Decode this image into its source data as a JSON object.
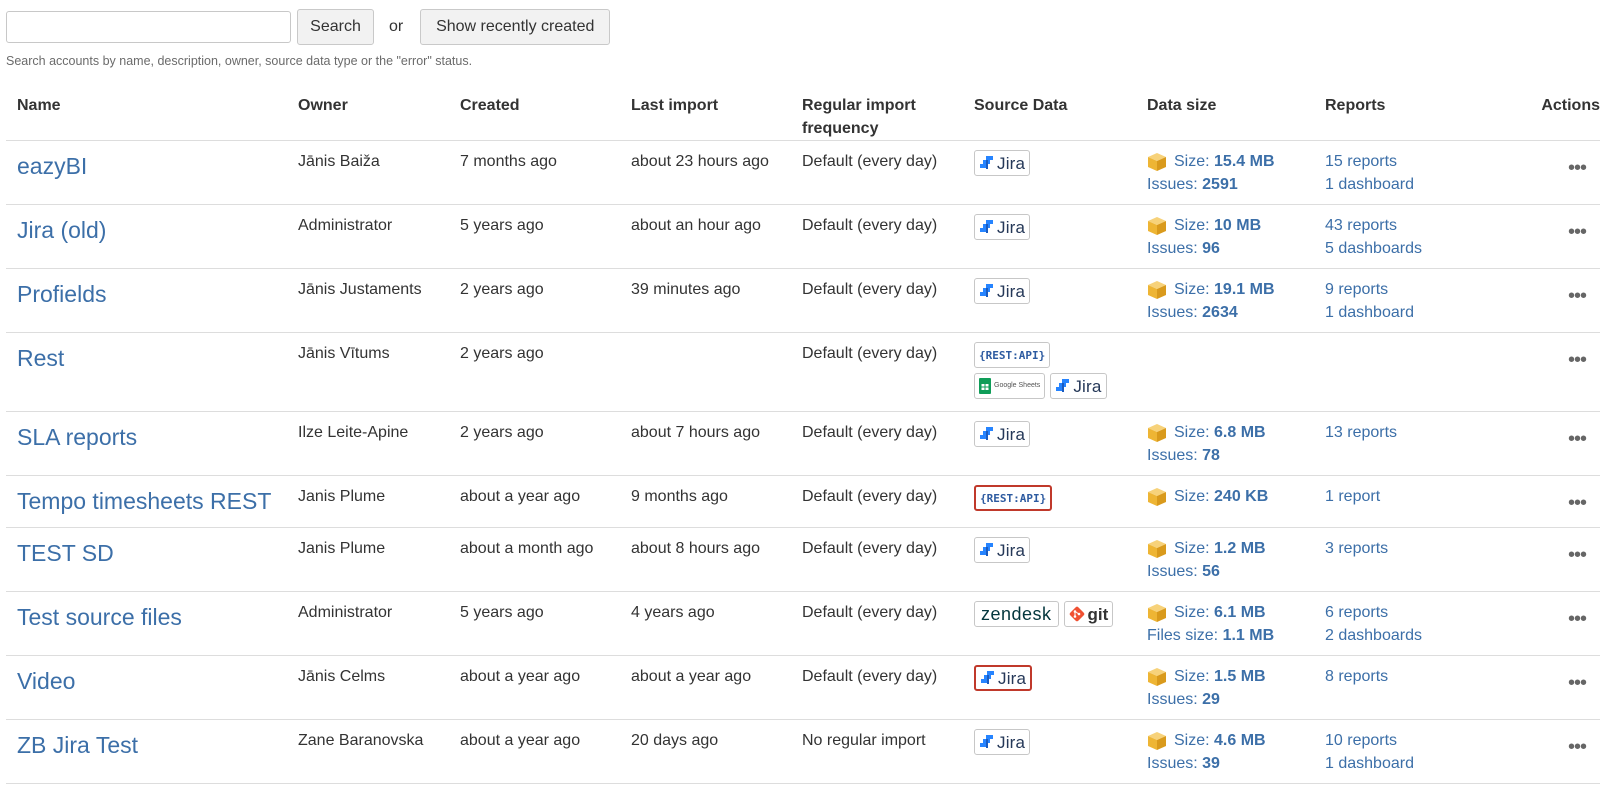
{
  "search": {
    "placeholder": "",
    "value": "",
    "button_label": "Search",
    "or_label": "or",
    "recent_label": "Show recently created"
  },
  "help_text": "Search accounts by name, description, owner, source data type or the \"error\" status.",
  "columns": {
    "name": "Name",
    "owner": "Owner",
    "created": "Created",
    "last_import": "Last import",
    "frequency": "Regular import frequency",
    "source": "Source Data",
    "size": "Data size",
    "reports": "Reports",
    "actions": "Actions"
  },
  "labels": {
    "size": "Size:",
    "issues": "Issues:",
    "files_size": "Files size:"
  },
  "colors": {
    "link": "#3c6fa8",
    "error_border": "#c0392b",
    "box_icon": "#f2bf3f"
  },
  "rows": [
    {
      "name": "eazyBI",
      "owner": "Jānis Baiža",
      "created": "7 months ago",
      "last_import": "about 23 hours ago",
      "frequency": "Default (every day)",
      "sources": [
        {
          "type": "jira",
          "label": "Jira",
          "error": false
        }
      ],
      "size": "15.4 MB",
      "extra_label": "Issues:",
      "extra_value": "2591",
      "reports": "15 reports",
      "dashboards": "1 dashboard"
    },
    {
      "name": "Jira (old)",
      "owner": "Administrator",
      "created": "5 years ago",
      "last_import": "about an hour ago",
      "frequency": "Default (every day)",
      "sources": [
        {
          "type": "jira",
          "label": "Jira",
          "error": false
        }
      ],
      "size": "10 MB",
      "extra_label": "Issues:",
      "extra_value": "96",
      "reports": "43 reports",
      "dashboards": "5 dashboards"
    },
    {
      "name": "Profields",
      "owner": "Jānis Justaments",
      "created": "2 years ago",
      "last_import": "39 minutes ago",
      "frequency": "Default (every day)",
      "sources": [
        {
          "type": "jira",
          "label": "Jira",
          "error": false
        }
      ],
      "size": "19.1 MB",
      "extra_label": "Issues:",
      "extra_value": "2634",
      "reports": "9 reports",
      "dashboards": "1 dashboard"
    },
    {
      "name": "Rest",
      "owner": "Jānis Vītums",
      "created": "2 years ago",
      "last_import": "",
      "frequency": "Default (every day)",
      "sources": [
        {
          "type": "rest",
          "label": "{REST:API}",
          "error": false
        },
        {
          "type": "gsheets",
          "label": "Google Sheets",
          "error": false
        },
        {
          "type": "jira",
          "label": "Jira",
          "error": false
        }
      ],
      "size": "",
      "extra_label": "",
      "extra_value": "",
      "reports": "",
      "dashboards": ""
    },
    {
      "name": "SLA reports",
      "owner": "Ilze Leite-Apine",
      "created": "2 years ago",
      "last_import": "about 7 hours ago",
      "frequency": "Default (every day)",
      "sources": [
        {
          "type": "jira",
          "label": "Jira",
          "error": false
        }
      ],
      "size": "6.8 MB",
      "extra_label": "Issues:",
      "extra_value": "78",
      "reports": "13 reports",
      "dashboards": ""
    },
    {
      "name": "Tempo timesheets REST",
      "owner": "Janis Plume",
      "created": "about a year ago",
      "last_import": "9 months ago",
      "frequency": "Default (every day)",
      "sources": [
        {
          "type": "rest",
          "label": "{REST:API}",
          "error": true
        }
      ],
      "size": "240 KB",
      "extra_label": "",
      "extra_value": "",
      "reports": "1 report",
      "dashboards": ""
    },
    {
      "name": "TEST SD",
      "owner": "Janis Plume",
      "created": "about a month ago",
      "last_import": "about 8 hours ago",
      "frequency": "Default (every day)",
      "sources": [
        {
          "type": "jira",
          "label": "Jira",
          "error": false
        }
      ],
      "size": "1.2 MB",
      "extra_label": "Issues:",
      "extra_value": "56",
      "reports": "3 reports",
      "dashboards": ""
    },
    {
      "name": "Test source files",
      "owner": "Administrator",
      "created": "5 years ago",
      "last_import": "4 years ago",
      "frequency": "Default (every day)",
      "sources": [
        {
          "type": "zendesk",
          "label": "zendesk",
          "error": false
        },
        {
          "type": "git",
          "label": "git",
          "error": false
        }
      ],
      "size": "6.1 MB",
      "extra_label": "Files size:",
      "extra_value": "1.1 MB",
      "reports": "6 reports",
      "dashboards": "2 dashboards"
    },
    {
      "name": "Video",
      "owner": "Jānis Celms",
      "created": "about a year ago",
      "last_import": "about a year ago",
      "frequency": "Default (every day)",
      "sources": [
        {
          "type": "jira",
          "label": "Jira",
          "error": true
        }
      ],
      "size": "1.5 MB",
      "extra_label": "Issues:",
      "extra_value": "29",
      "reports": "8 reports",
      "dashboards": ""
    },
    {
      "name": "ZB Jira Test",
      "owner": "Zane Baranovska",
      "created": "about a year ago",
      "last_import": "20 days ago",
      "frequency": "No regular import",
      "sources": [
        {
          "type": "jira",
          "label": "Jira",
          "error": false
        }
      ],
      "size": "4.6 MB",
      "extra_label": "Issues:",
      "extra_value": "39",
      "reports": "10 reports",
      "dashboards": "1 dashboard"
    }
  ],
  "actions_icon": "ellipsis-icon",
  "source_icons": {
    "jira": "jira-logo-icon",
    "rest": "rest-api-logo",
    "gsheets": "google-sheets-icon",
    "zendesk": "zendesk-logo",
    "git": "git-logo-icon"
  },
  "size_icon": "cube-icon"
}
